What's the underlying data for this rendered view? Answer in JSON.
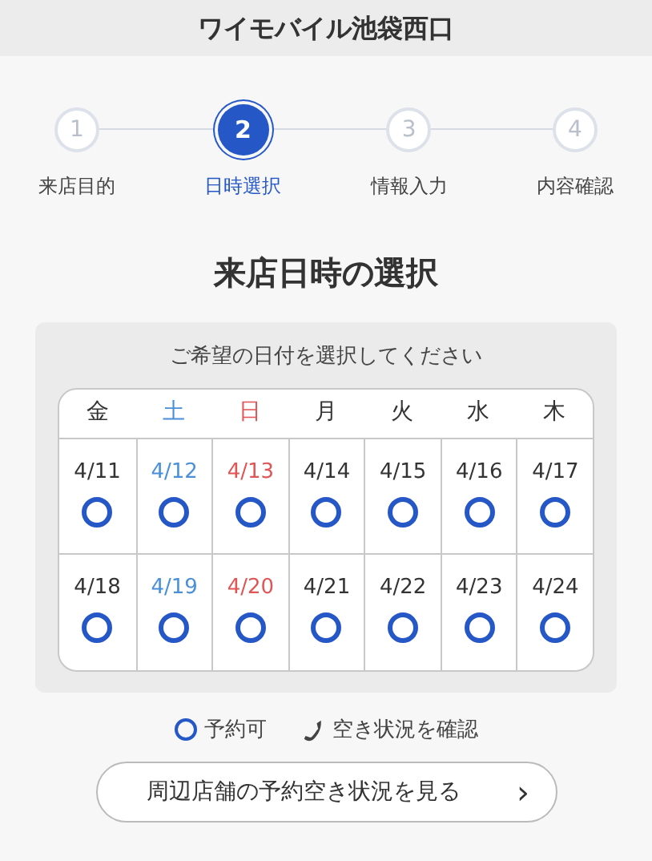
{
  "header": {
    "title": "ワイモバイル池袋西口"
  },
  "steps": [
    {
      "number": "1",
      "label": "来店目的",
      "selected": false
    },
    {
      "number": "2",
      "label": "日時選択",
      "selected": true
    },
    {
      "number": "3",
      "label": "情報入力",
      "selected": false
    },
    {
      "number": "4",
      "label": "内容確認",
      "selected": false
    }
  ],
  "heading": "来店日時の選択",
  "calendar": {
    "prompt": "ご希望の日付を選択してください",
    "weekdays": [
      {
        "label": "金",
        "kind": "weekday"
      },
      {
        "label": "土",
        "kind": "saturday"
      },
      {
        "label": "日",
        "kind": "sunday"
      },
      {
        "label": "月",
        "kind": "weekday"
      },
      {
        "label": "火",
        "kind": "weekday"
      },
      {
        "label": "水",
        "kind": "weekday"
      },
      {
        "label": "木",
        "kind": "weekday"
      }
    ],
    "weeks": [
      [
        {
          "date": "4/11",
          "kind": "weekday",
          "available": true
        },
        {
          "date": "4/12",
          "kind": "saturday",
          "available": true
        },
        {
          "date": "4/13",
          "kind": "sunday",
          "available": true
        },
        {
          "date": "4/14",
          "kind": "weekday",
          "available": true
        },
        {
          "date": "4/15",
          "kind": "weekday",
          "available": true
        },
        {
          "date": "4/16",
          "kind": "weekday",
          "available": true
        },
        {
          "date": "4/17",
          "kind": "weekday",
          "available": true
        }
      ],
      [
        {
          "date": "4/18",
          "kind": "weekday",
          "available": true
        },
        {
          "date": "4/19",
          "kind": "saturday",
          "available": true
        },
        {
          "date": "4/20",
          "kind": "sunday",
          "available": true
        },
        {
          "date": "4/21",
          "kind": "weekday",
          "available": true
        },
        {
          "date": "4/22",
          "kind": "weekday",
          "available": true
        },
        {
          "date": "4/23",
          "kind": "weekday",
          "available": true
        },
        {
          "date": "4/24",
          "kind": "weekday",
          "available": true
        }
      ]
    ]
  },
  "legend": [
    {
      "kind": "available",
      "label": "予約可"
    },
    {
      "kind": "phone",
      "label": "空き状況を確認"
    }
  ],
  "nearby_button": {
    "label": "周辺店舗の予約空き状況を見る",
    "arrow": "›"
  }
}
